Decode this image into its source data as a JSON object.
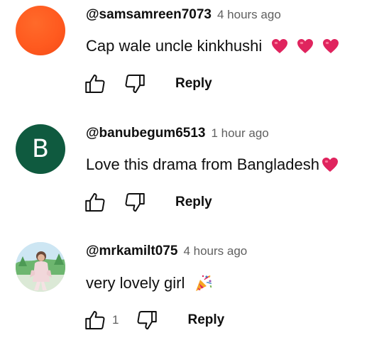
{
  "comments": [
    {
      "author": "@samsamreen7073",
      "time": "4 hours ago",
      "text": "Cap wale uncle kinkhushi",
      "reply_label": "Reply"
    },
    {
      "author": "@banubegum6513",
      "time": "1 hour ago",
      "avatar_letter": "B",
      "text": "Love this drama from Bangladesh",
      "reply_label": "Reply"
    },
    {
      "author": "@mrkamilt075",
      "time": "4 hours ago",
      "text": "very lovely girl",
      "like_count": "1",
      "reply_label": "Reply"
    }
  ],
  "colors": {
    "text": "#0f0f0f",
    "secondary": "#606060",
    "avatar_orange": "#ff5a1f",
    "avatar_green": "#0f5a3f",
    "heart": "#e0245e"
  },
  "icons": [
    "thumbs-up-icon",
    "thumbs-down-icon",
    "heart-emoji",
    "party-popper-emoji"
  ]
}
